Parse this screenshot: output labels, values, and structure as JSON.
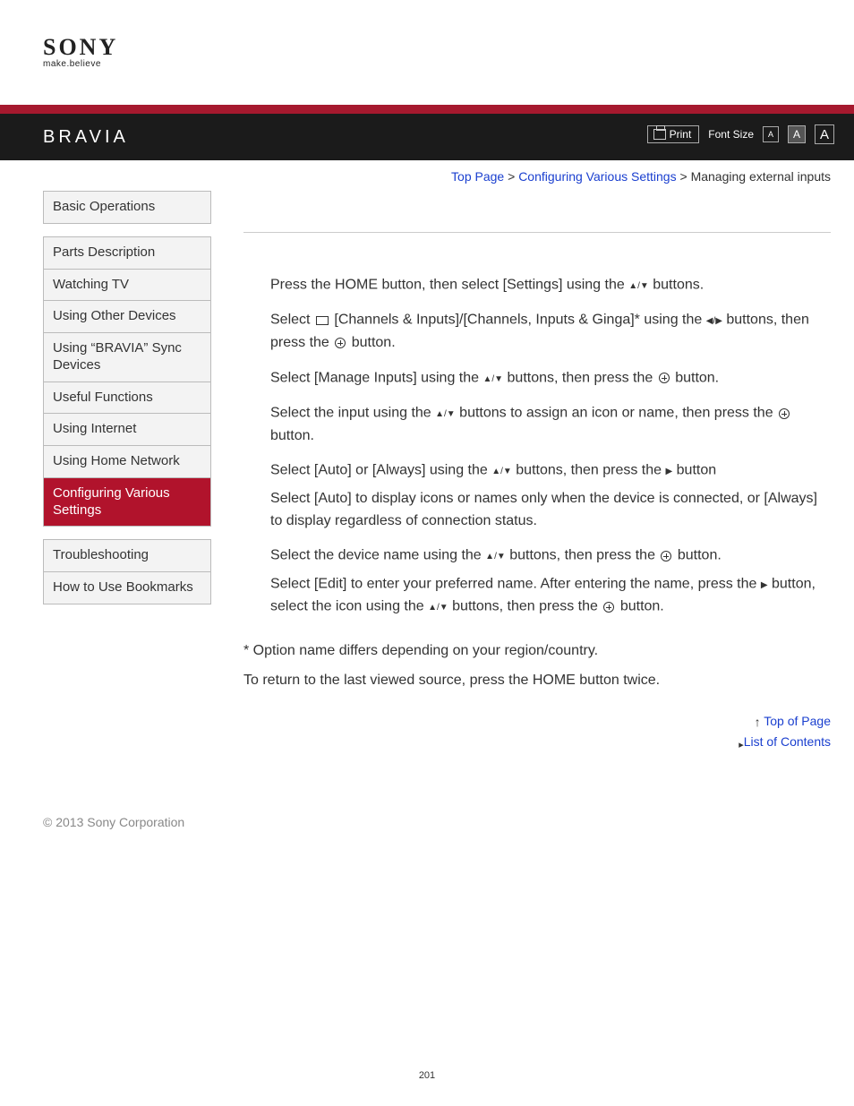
{
  "logo": {
    "brand": "SONY",
    "tagline": "make.believe"
  },
  "header": {
    "product": "BRAVIA",
    "print": "Print",
    "font_size_label": "Font Size",
    "font_A": "A"
  },
  "breadcrumb": {
    "top": "Top Page",
    "sep": " > ",
    "section": "Configuring Various Settings",
    "current": "Managing external inputs"
  },
  "sidebar": {
    "group1": [
      "Basic Operations"
    ],
    "group2": [
      "Parts Description",
      "Watching TV",
      "Using Other Devices",
      "Using “BRAVIA” Sync Devices",
      "Useful Functions",
      "Using Internet",
      "Using Home Network",
      "Configuring Various Settings"
    ],
    "group3": [
      "Troubleshooting",
      "How to Use Bookmarks"
    ],
    "active": "Configuring Various Settings"
  },
  "content": {
    "s1a": "Press the HOME button, then select [Settings] using the ",
    "s1b": " buttons.",
    "s2a": "Select ",
    "s2b": " [Channels & Inputs]/[Channels, Inputs & Ginga]* using the ",
    "s2c": " buttons, then press the ",
    "s2d": " button.",
    "s3a": "Select [Manage Inputs] using the ",
    "s3b": " buttons, then press the ",
    "s3c": " button.",
    "s4a": "Select the input using the ",
    "s4b": " buttons to assign an icon or name, then press the ",
    "s4c": " button.",
    "s5a": "Select [Auto] or [Always] using the ",
    "s5b": " buttons, then press the ",
    "s5c": " button",
    "s5sub": "Select [Auto] to display icons or names only when the device is connected, or [Always] to display regardless of connection status.",
    "s6a": "Select the device name using the ",
    "s6b": " buttons, then press the ",
    "s6c": " button.",
    "s6sub_a": "Select [Edit] to enter your preferred name. After entering the name, press the ",
    "s6sub_b": " button, select the icon using the ",
    "s6sub_c": " buttons, then press the ",
    "s6sub_d": " button.",
    "note1": "* Option name differs depending on your region/country.",
    "note2": "To return to the last viewed source, press the HOME button twice."
  },
  "bottom": {
    "top_of_page": "Top of Page",
    "list_contents": "List of Contents"
  },
  "copyright": "© 2013 Sony Corporation",
  "page_number": "201"
}
